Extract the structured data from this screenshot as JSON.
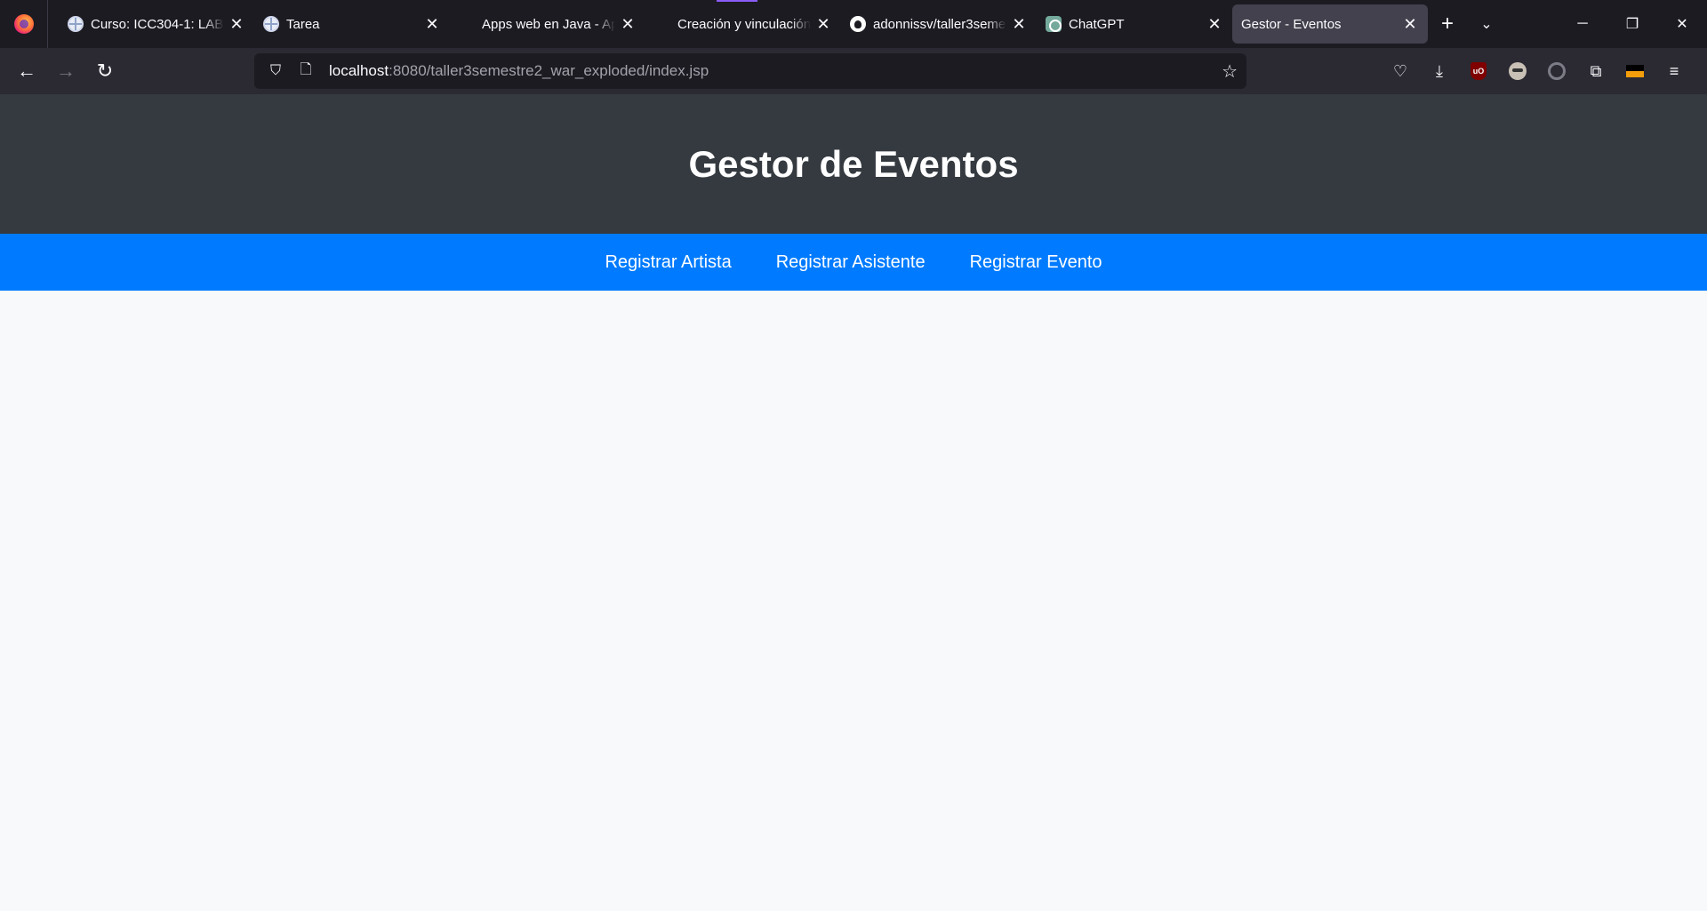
{
  "browser": {
    "tabs": [
      {
        "title": "Curso: ICC304-1: LABO",
        "icon": "globe-icon",
        "active": false,
        "closable": true
      },
      {
        "title": "Tarea",
        "icon": "globe-icon",
        "active": false,
        "closable": true
      },
      {
        "title": "Apps web en Java - Apps w",
        "icon": "",
        "active": false,
        "closable": true
      },
      {
        "title": "Creación y vinculación con",
        "icon": "",
        "active": false,
        "closable": true
      },
      {
        "title": "adonnissv/taller3seme",
        "icon": "github-icon",
        "active": false,
        "closable": true
      },
      {
        "title": "ChatGPT",
        "icon": "chatgpt-icon",
        "active": false,
        "closable": true
      },
      {
        "title": "Gestor - Eventos",
        "icon": "",
        "active": true,
        "closable": true
      }
    ],
    "url": {
      "host": "localhost",
      "path": ":8080/taller3semestre2_war_exploded/index.jsp"
    },
    "accent_color": "#8b5cf6"
  },
  "page": {
    "header": {
      "title": "Gestor de Eventos",
      "background": "#343a40"
    },
    "nav": {
      "background": "#007bff",
      "links": [
        {
          "label": "Registrar Artista"
        },
        {
          "label": "Registrar Asistente"
        },
        {
          "label": "Registrar Evento"
        }
      ]
    },
    "body_background": "#f8f9fa"
  }
}
